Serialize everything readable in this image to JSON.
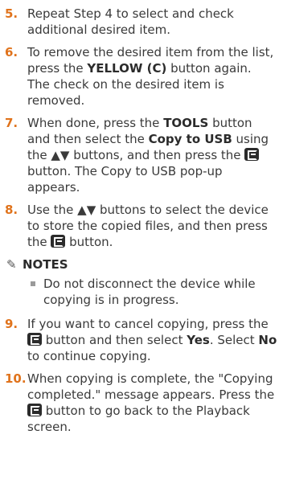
{
  "steps": {
    "s5": {
      "num": "5.",
      "text": "Repeat Step 4 to select and check additional desired item."
    },
    "s6": {
      "num": "6.",
      "t1": "To remove the desired item from the list, press the ",
      "yellow": "YELLOW (C)",
      "t2": " button again.",
      "t3": "The check on the desired item is removed."
    },
    "s7": {
      "num": "7.",
      "t1": "When done, press the ",
      "tools": "TOOLS",
      "t2": " button and then select the ",
      "copy": "Copy to USB",
      "t3": " using the ▲▼ buttons, and then press the ",
      "t4": " button. The Copy to USB pop-up appears."
    },
    "s8": {
      "num": "8.",
      "t1": "Use the ▲▼ buttons to select the device to store the copied files, and then press the ",
      "t2": " button."
    },
    "notes": {
      "icon": "✎",
      "heading": "NOTES",
      "item": "Do not disconnect the device while copying is in progress."
    },
    "s9": {
      "num": "9.",
      "t1": "If you want to cancel copying, press the ",
      "t2": " button and then select ",
      "yes": "Yes",
      "t3": ". Select ",
      "no": "No",
      "t4": " to continue copying."
    },
    "s10": {
      "num": "10.",
      "t1": "When copying is complete, the \"Copying completed.\" message appears. Press the ",
      "t2": " button to go back to the Playback screen."
    }
  }
}
